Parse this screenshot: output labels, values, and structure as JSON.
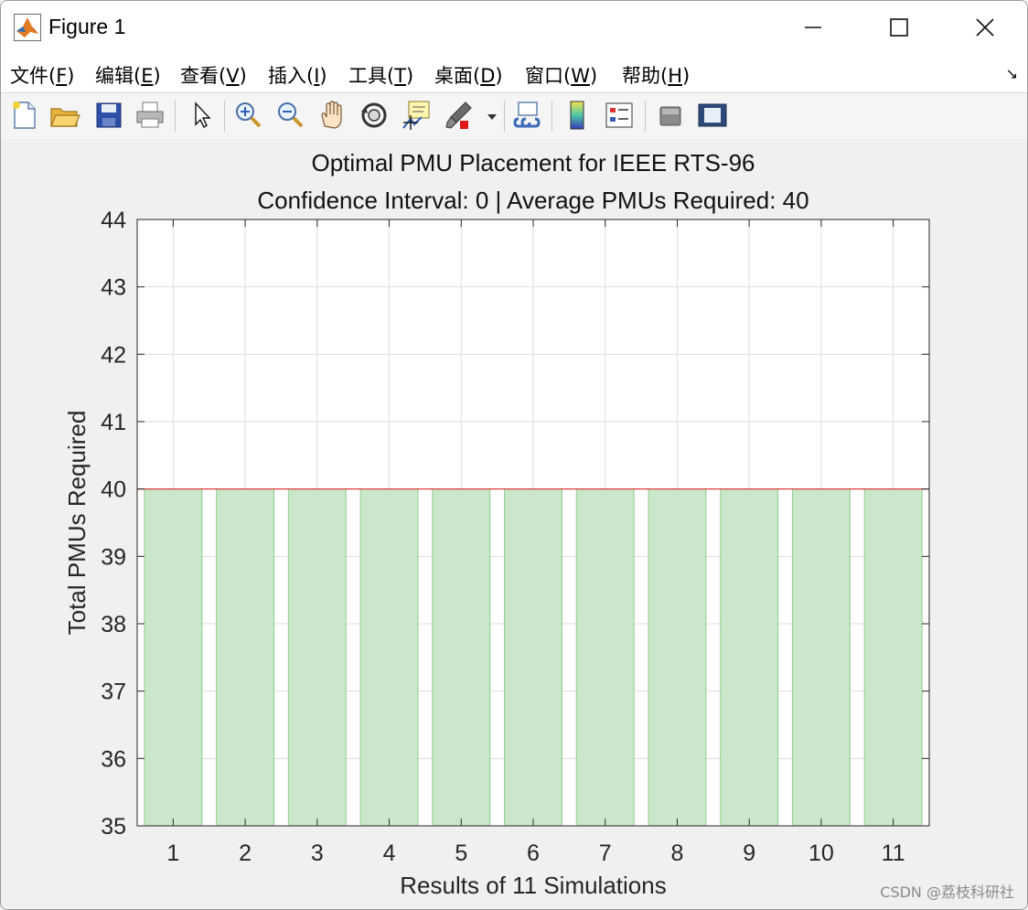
{
  "window": {
    "title": "Figure 1",
    "minimize_glyph": "—",
    "maximize_glyph": "☐",
    "close_glyph": "✕"
  },
  "menu": {
    "items": [
      {
        "label": "文件(",
        "mnemonic": "F",
        "suffix": ")"
      },
      {
        "label": "编辑(",
        "mnemonic": "E",
        "suffix": ")"
      },
      {
        "label": "查看(",
        "mnemonic": "V",
        "suffix": ")"
      },
      {
        "label": "插入(",
        "mnemonic": "I",
        "suffix": ")"
      },
      {
        "label": "工具(",
        "mnemonic": "T",
        "suffix": ")"
      },
      {
        "label": "桌面(",
        "mnemonic": "D",
        "suffix": ")"
      },
      {
        "label": "窗口(",
        "mnemonic": "W",
        "suffix": ")"
      },
      {
        "label": "帮助(",
        "mnemonic": "H",
        "suffix": ")"
      }
    ],
    "dock_arrow": "↘"
  },
  "toolbar": {
    "icons": [
      "new-figure-icon",
      "open-file-icon",
      "save-icon",
      "print-icon",
      "select-arrow-icon",
      "zoom-in-icon",
      "zoom-out-icon",
      "pan-hand-icon",
      "rotate-3d-icon",
      "data-cursor-icon",
      "brush-icon",
      "link-plot-icon",
      "colorbar-icon",
      "legend-icon",
      "hide-plot-tools-icon",
      "show-plot-tools-icon"
    ]
  },
  "chart_data": {
    "type": "bar",
    "title": "Optimal PMU Placement for IEEE RTS-96",
    "subtitle": "Confidence Interval: 0 | Average PMUs Required: 40",
    "xlabel": "Results of 11 Simulations",
    "ylabel": "Total PMUs Required",
    "categories": [
      "1",
      "2",
      "3",
      "4",
      "5",
      "6",
      "7",
      "8",
      "9",
      "10",
      "11"
    ],
    "values": [
      40,
      40,
      40,
      40,
      40,
      40,
      40,
      40,
      40,
      40,
      40
    ],
    "ylim": [
      35,
      44
    ],
    "yticks": [
      "35",
      "36",
      "37",
      "38",
      "39",
      "40",
      "41",
      "42",
      "43",
      "44"
    ],
    "reference_line": 40,
    "grid": true,
    "bar_color": "#cbe6cb",
    "bar_edge_color": "#8fd08f",
    "line_color": "#e03030"
  },
  "watermark": "CSDN @荔枝科研社"
}
